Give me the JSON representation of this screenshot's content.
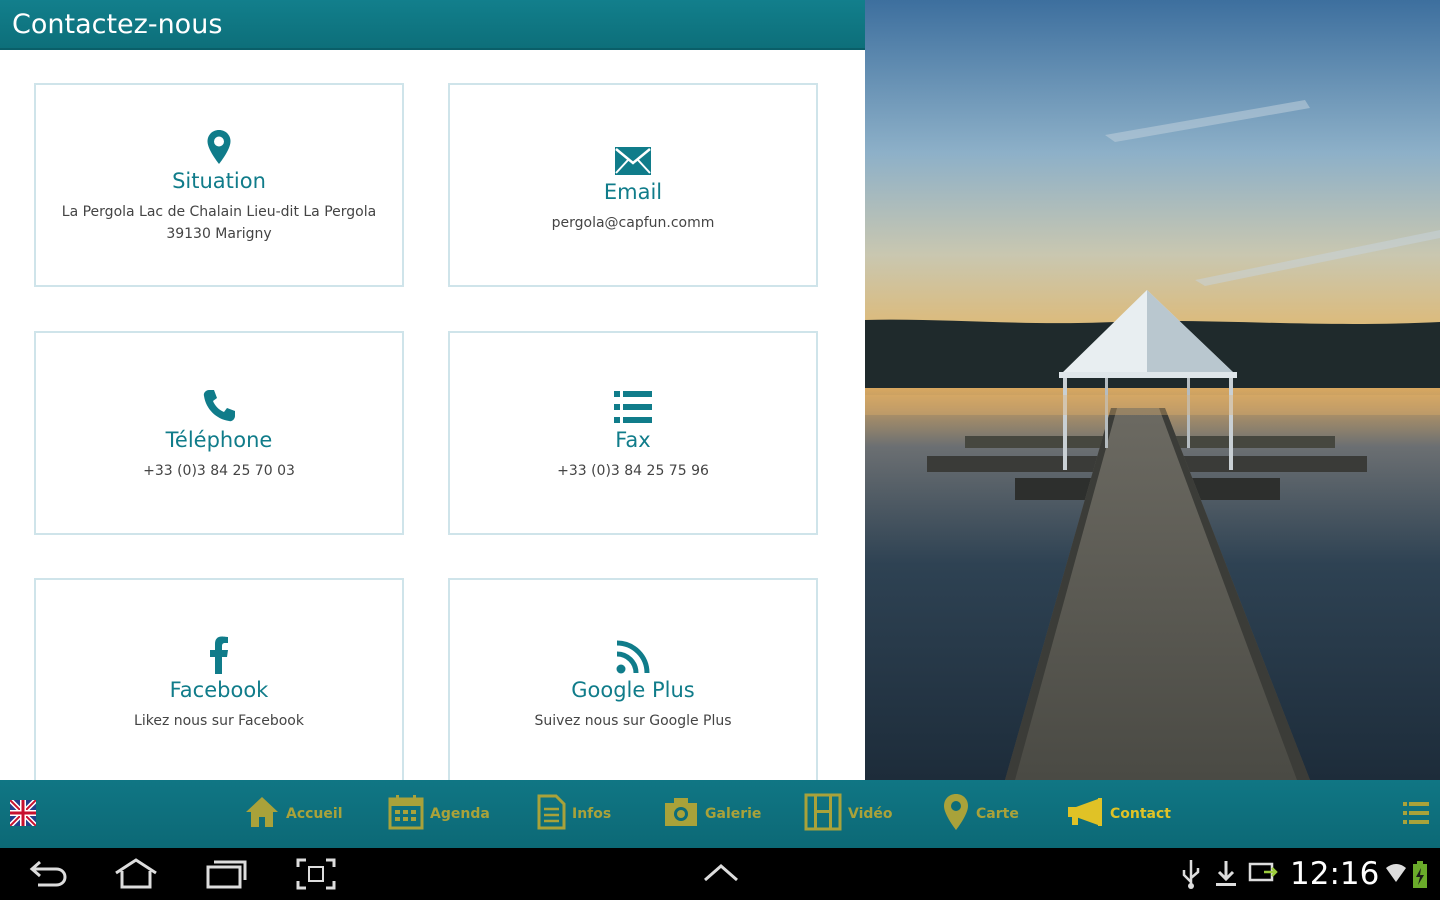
{
  "header": {
    "title": "Contactez-nous"
  },
  "cards": [
    {
      "title": "Situation",
      "subtitle_line1": "La Pergola Lac de Chalain Lieu-dit La Pergola",
      "subtitle_line2": "39130 Marigny",
      "icon": "map-pin-icon"
    },
    {
      "title": "Email",
      "subtitle": "pergola@capfun.comm",
      "icon": "envelope-icon"
    },
    {
      "title": "Téléphone",
      "subtitle": "+33 (0)3 84 25 70 03",
      "icon": "phone-icon"
    },
    {
      "title": "Fax",
      "subtitle": "+33 (0)3 84 25 75 96",
      "icon": "list-icon"
    },
    {
      "title": "Facebook",
      "subtitle": "Likez nous sur Facebook",
      "icon": "facebook-icon"
    },
    {
      "title": "Google Plus",
      "subtitle": "Suivez nous sur Google Plus",
      "icon": "rss-icon"
    }
  ],
  "nav": {
    "items": [
      {
        "label": "Accueil",
        "icon": "home-icon"
      },
      {
        "label": "Agenda",
        "icon": "calendar-icon"
      },
      {
        "label": "Infos",
        "icon": "document-icon"
      },
      {
        "label": "Galerie",
        "icon": "camera-icon"
      },
      {
        "label": "Vidéo",
        "icon": "film-icon"
      },
      {
        "label": "Carte",
        "icon": "map-pin-icon"
      },
      {
        "label": "Contact",
        "icon": "megaphone-icon",
        "active": true
      }
    ],
    "language_icon": "uk-flag-icon",
    "menu_icon": "hamburger-icon"
  },
  "system": {
    "time": "12:16"
  },
  "colors": {
    "accent": "#107c8a",
    "nav_label": "#a9a23a",
    "nav_active": "#e0c226"
  }
}
